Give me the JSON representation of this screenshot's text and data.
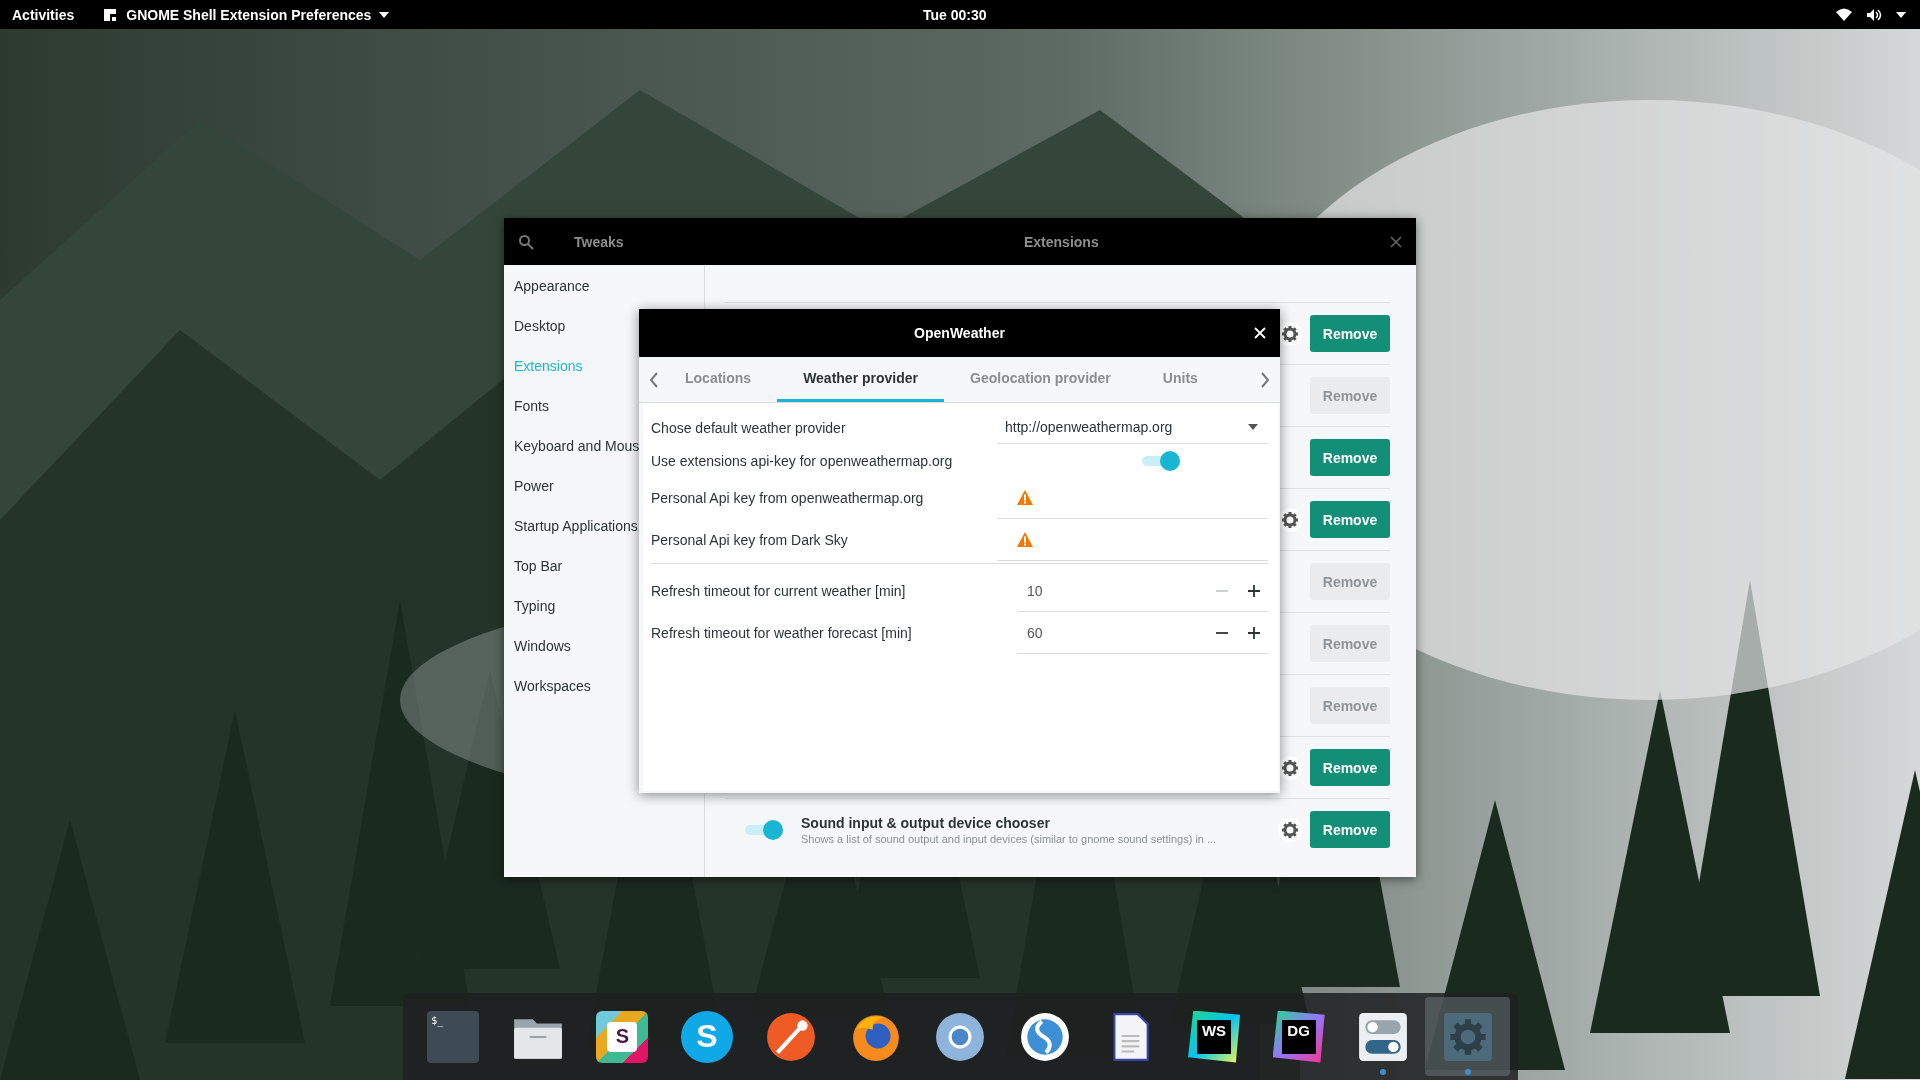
{
  "top_bar": {
    "activities": "Activities",
    "app_menu": "GNOME Shell Extension Preferences",
    "clock": "Tue 00:30"
  },
  "tweaks_window": {
    "app_title": "Tweaks",
    "page_title": "Extensions",
    "sidebar": [
      {
        "label": "Appearance",
        "selected": false
      },
      {
        "label": "Desktop",
        "selected": false
      },
      {
        "label": "Extensions",
        "selected": true
      },
      {
        "label": "Fonts",
        "selected": false
      },
      {
        "label": "Keyboard and Mous",
        "selected": false
      },
      {
        "label": "Power",
        "selected": false
      },
      {
        "label": "Startup Applications",
        "selected": false
      },
      {
        "label": "Top Bar",
        "selected": false
      },
      {
        "label": "Typing",
        "selected": false
      },
      {
        "label": "Windows",
        "selected": false
      },
      {
        "label": "Workspaces",
        "selected": false
      }
    ],
    "extensions": [
      {
        "settings": true,
        "remove": "Remove",
        "disabled": false
      },
      {
        "settings": false,
        "remove": "Remove",
        "disabled": true
      },
      {
        "settings": false,
        "remove": "Remove",
        "disabled": false
      },
      {
        "settings": true,
        "remove": "Remove",
        "disabled": false
      },
      {
        "settings": false,
        "remove": "Remove",
        "disabled": true
      },
      {
        "settings": false,
        "remove": "Remove",
        "disabled": true
      },
      {
        "settings": false,
        "remove": "Remove",
        "disabled": true
      },
      {
        "settings": true,
        "remove": "Remove",
        "disabled": false
      },
      {
        "settings": true,
        "remove": "Remove",
        "disabled": false,
        "name": "Sound input & output device chooser",
        "description": "Shows a list of sound output and input devices (similar to gnome sound settings) in ...",
        "on": true
      }
    ]
  },
  "dialog": {
    "title": "OpenWeather",
    "tabs": [
      {
        "label": "Locations",
        "selected": false
      },
      {
        "label": "Weather provider",
        "selected": true
      },
      {
        "label": "Geolocation provider",
        "selected": false
      },
      {
        "label": "Units",
        "selected": false
      }
    ],
    "settings": [
      {
        "kind": "dropdown",
        "label": "Chose default weather provider",
        "value": "http://openweathermap.org"
      },
      {
        "kind": "switch",
        "label": "Use extensions api-key for openweathermap.org",
        "on": true
      },
      {
        "kind": "entry",
        "label": "Personal Api key from openweathermap.org",
        "warning": true
      },
      {
        "kind": "entry",
        "label": "Personal Api key from Dark Sky",
        "warning": true
      },
      {
        "kind": "spin",
        "label": "Refresh timeout for current weather [min]",
        "value": "10",
        "minus_disabled": true
      },
      {
        "kind": "spin",
        "label": "Refresh timeout for weather forecast [min]",
        "value": "60",
        "minus_disabled": false
      }
    ]
  },
  "dock": [
    {
      "kind": "terminal",
      "label": "$_",
      "running": false,
      "selected": false
    },
    {
      "kind": "folder",
      "running": false,
      "selected": false
    },
    {
      "kind": "slack",
      "label": "S",
      "running": false,
      "selected": false
    },
    {
      "kind": "skype",
      "label": "S",
      "running": false,
      "selected": false
    },
    {
      "kind": "postman",
      "running": false,
      "selected": false
    },
    {
      "kind": "firefox",
      "running": false,
      "selected": false
    },
    {
      "kind": "chromium",
      "running": false,
      "selected": false
    },
    {
      "kind": "simplenote",
      "running": false,
      "selected": false
    },
    {
      "kind": "document",
      "running": false,
      "selected": false
    },
    {
      "kind": "webstorm",
      "label": "WS",
      "running": false,
      "selected": false
    },
    {
      "kind": "datagrip",
      "label": "DG",
      "running": false,
      "selected": false
    },
    {
      "kind": "tweaks",
      "running": true,
      "selected": false
    },
    {
      "kind": "settings",
      "running": true,
      "selected": true
    }
  ]
}
